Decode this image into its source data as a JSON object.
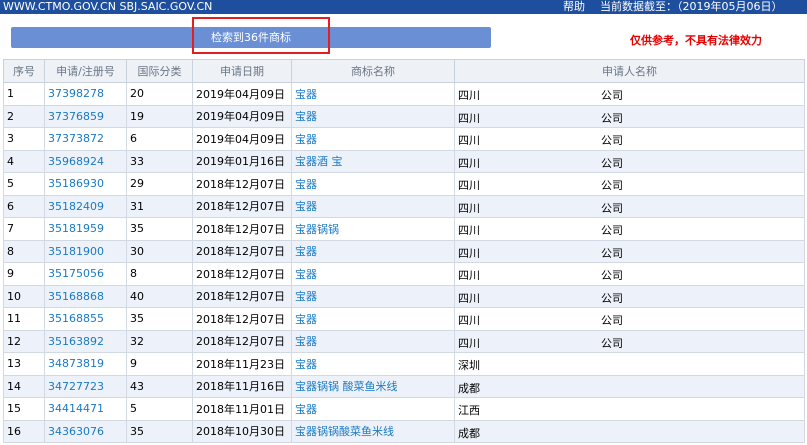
{
  "topbar": {
    "sites": "WWW.CTMO.GOV.CN SBJ.SAIC.GOV.CN",
    "help": "帮助",
    "data_cutoff": "当前数据截至：（2019年05月06日）"
  },
  "search_result_banner": "检索到36件商标",
  "disclaimer": "仅供参考，不具有法律效力",
  "colors": {
    "topbar": "#1e4e9e",
    "banner": "#6a8fd5",
    "link": "#1a7ac4",
    "disclaimer": "#e60000",
    "highlight_box": "#e02020",
    "row_alt": "#edf2fa"
  },
  "table": {
    "columns": [
      "序号",
      "申请/注册号",
      "国际分类",
      "申请日期",
      "商标名称",
      "申请人名称"
    ],
    "rows": [
      {
        "no": "1",
        "reg": "37398278",
        "cls": "20",
        "date": "2019年04月09日",
        "name": "宝器",
        "applicant": "四川",
        "tail": "公司"
      },
      {
        "no": "2",
        "reg": "37376859",
        "cls": "19",
        "date": "2019年04月09日",
        "name": "宝器",
        "applicant": "四川",
        "tail": "公司"
      },
      {
        "no": "3",
        "reg": "37373872",
        "cls": "6",
        "date": "2019年04月09日",
        "name": "宝器",
        "applicant": "四川",
        "tail": "公司"
      },
      {
        "no": "4",
        "reg": "35968924",
        "cls": "33",
        "date": "2019年01月16日",
        "name": "宝器酒 宝",
        "applicant": "四川",
        "tail": "公司"
      },
      {
        "no": "5",
        "reg": "35186930",
        "cls": "29",
        "date": "2018年12月07日",
        "name": "宝器",
        "applicant": "四川",
        "tail": "公司"
      },
      {
        "no": "6",
        "reg": "35182409",
        "cls": "31",
        "date": "2018年12月07日",
        "name": "宝器",
        "applicant": "四川",
        "tail": "公司"
      },
      {
        "no": "7",
        "reg": "35181959",
        "cls": "35",
        "date": "2018年12月07日",
        "name": "宝器锅锅",
        "applicant": "四川",
        "tail": "公司"
      },
      {
        "no": "8",
        "reg": "35181900",
        "cls": "30",
        "date": "2018年12月07日",
        "name": "宝器",
        "applicant": "四川",
        "tail": "公司"
      },
      {
        "no": "9",
        "reg": "35175056",
        "cls": "8",
        "date": "2018年12月07日",
        "name": "宝器",
        "applicant": "四川",
        "tail": "公司"
      },
      {
        "no": "10",
        "reg": "35168868",
        "cls": "40",
        "date": "2018年12月07日",
        "name": "宝器",
        "applicant": "四川",
        "tail": "公司"
      },
      {
        "no": "11",
        "reg": "35168855",
        "cls": "35",
        "date": "2018年12月07日",
        "name": "宝器",
        "applicant": "四川",
        "tail": "公司"
      },
      {
        "no": "12",
        "reg": "35163892",
        "cls": "32",
        "date": "2018年12月07日",
        "name": "宝器",
        "applicant": "四川",
        "tail": "公司"
      },
      {
        "no": "13",
        "reg": "34873819",
        "cls": "9",
        "date": "2018年11月23日",
        "name": "宝器",
        "applicant": "深圳",
        "tail": ""
      },
      {
        "no": "14",
        "reg": "34727723",
        "cls": "43",
        "date": "2018年11月16日",
        "name": "宝器锅锅 酸菜鱼米线",
        "applicant": "成都",
        "tail": ""
      },
      {
        "no": "15",
        "reg": "34414471",
        "cls": "5",
        "date": "2018年11月01日",
        "name": "宝器",
        "applicant": "江西",
        "tail": ""
      },
      {
        "no": "16",
        "reg": "34363076",
        "cls": "35",
        "date": "2018年10月30日",
        "name": "宝器锅锅酸菜鱼米线",
        "applicant": "成都",
        "tail": ""
      }
    ]
  }
}
